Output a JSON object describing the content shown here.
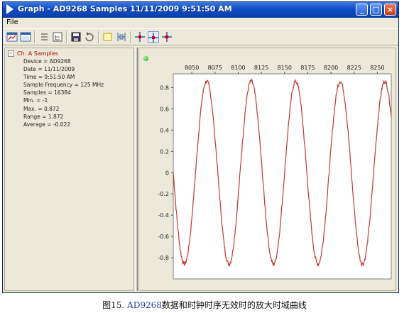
{
  "window": {
    "title": "Graph - AD9268 Samples 11/11/2009 9:51:50 AM",
    "controls": {
      "minimize": "_",
      "maximize": "□",
      "close": "×"
    }
  },
  "menu": {
    "file": "File"
  },
  "toolbar": {
    "buttons": [
      "graph-icon",
      "window-icon",
      "list-icon",
      "tree-icon",
      "save-icon",
      "refresh-icon",
      "zoom-box-icon",
      "zoom-fit-icon",
      "crosshair-icon",
      "crosshair-active-icon",
      "crosshair-alt-icon"
    ]
  },
  "tree": {
    "root": "Ch. A Samples",
    "items": [
      "Device = AD9268",
      "Date = 11/11/2009",
      "Time = 9:51:50 AM",
      "Sample Frequency = 125 MHz",
      "Samples = 16384",
      "Min. = -1",
      "Max. = 0.872",
      "Range = 1.872",
      "Average = -0.022"
    ]
  },
  "colors": {
    "trace": "#c0392b",
    "title_bar": "#0f4dc4",
    "status": "#16a316"
  },
  "chart_data": {
    "type": "line",
    "x_ticks": [
      8050,
      8075,
      8100,
      8125,
      8150,
      8175,
      8200,
      8225,
      8250
    ],
    "y_ticks": [
      0.8,
      0.6,
      0.4,
      0.2,
      0,
      -0.2,
      -0.4,
      -0.6,
      -0.8
    ],
    "xlim": [
      8030,
      8265
    ],
    "ylim": [
      -1,
      0.93
    ],
    "x_axis_position": "top",
    "grid": false,
    "series": [
      {
        "period_samples": 48,
        "amplitude": 0.86,
        "x": [
          8030,
          8038,
          8054,
          8062,
          8078,
          8086,
          8102,
          8110,
          8126,
          8134,
          8150,
          8158,
          8174,
          8182,
          8198,
          8206,
          8222,
          8230,
          8246,
          8254,
          8264
        ],
        "y": [
          0,
          -0.86,
          0.86,
          0,
          -0.86,
          0,
          0.86,
          0,
          -0.86,
          0,
          0.86,
          0,
          -0.86,
          0,
          0.86,
          0,
          -0.86,
          0,
          0.86,
          0,
          0.7
        ]
      }
    ]
  },
  "caption": {
    "prefix": "图15. ",
    "part": "AD9268",
    "text": "数据和时钟时序无效时的放大时域曲线"
  }
}
